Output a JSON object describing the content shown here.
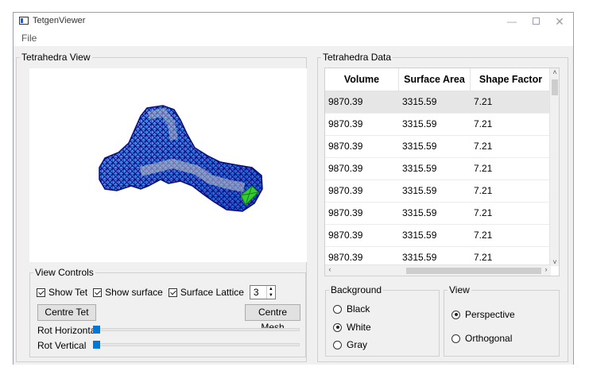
{
  "window": {
    "title": "TetgenViewer",
    "minimize_glyph": "—",
    "close_glyph": "✕"
  },
  "menu": {
    "file": "File"
  },
  "tetra_view": {
    "group_title": "Tetrahedra View"
  },
  "view_controls": {
    "group_title": "View Controls",
    "show_tet": {
      "label": "Show Tet",
      "checked": true
    },
    "show_surface": {
      "label": "Show surface",
      "checked": true
    },
    "surface_lattice": {
      "label": "Surface Lattice",
      "checked": true
    },
    "lattice_value": "3",
    "centre_tet": "Centre Tet",
    "centre_mesh": "Centre Mesh",
    "rot_horizontal": {
      "label": "Rot Horizontal",
      "value": 0
    },
    "rot_vertical": {
      "label": "Rot Vertical",
      "value": 0
    }
  },
  "tetra_data": {
    "group_title": "Tetrahedra Data",
    "columns": [
      "Volume",
      "Surface Area",
      "Shape Factor"
    ],
    "rows": [
      [
        "9870.39",
        "3315.59",
        "7.21"
      ],
      [
        "9870.39",
        "3315.59",
        "7.21"
      ],
      [
        "9870.39",
        "3315.59",
        "7.21"
      ],
      [
        "9870.39",
        "3315.59",
        "7.21"
      ],
      [
        "9870.39",
        "3315.59",
        "7.21"
      ],
      [
        "9870.39",
        "3315.59",
        "7.21"
      ],
      [
        "9870.39",
        "3315.59",
        "7.21"
      ],
      [
        "9870.39",
        "3315.59",
        "7.21"
      ]
    ]
  },
  "background": {
    "group_title": "Background",
    "options": [
      "Black",
      "White",
      "Gray"
    ],
    "selected": "White"
  },
  "view": {
    "group_title": "View",
    "options": [
      "Perspective",
      "Orthogonal"
    ],
    "selected": "Perspective"
  },
  "colors": {
    "mesh_fill": "#3a8ef0",
    "mesh_edge": "#0a0a7a",
    "highlight": "#33cc33",
    "slider": "#0078d7"
  }
}
